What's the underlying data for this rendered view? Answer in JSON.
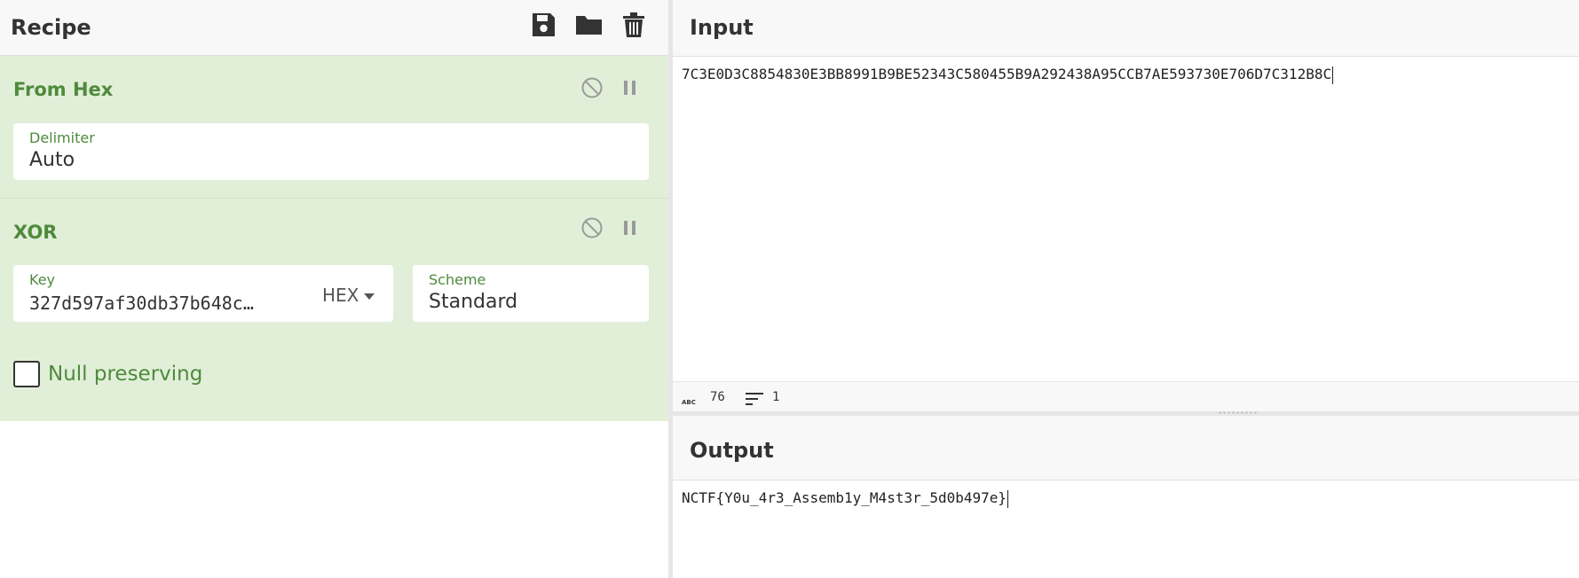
{
  "recipe": {
    "title": "Recipe",
    "icons": [
      "save-icon",
      "folder-icon",
      "trash-icon"
    ],
    "operations": [
      {
        "name": "From Hex",
        "fields": {
          "delimiter_label": "Delimiter",
          "delimiter_value": "Auto"
        }
      },
      {
        "name": "XOR",
        "fields": {
          "key_label": "Key",
          "key_value": "327d597af30db37b648c…",
          "key_format": "HEX",
          "scheme_label": "Scheme",
          "scheme_value": "Standard",
          "null_preserving_label": "Null preserving",
          "null_preserving_checked": false
        }
      }
    ]
  },
  "input": {
    "title": "Input",
    "text": "7C3E0D3C8854830E3BB8991B9BE52343C580455B9A292438A95CCB7AE593730E706D7C312B8C",
    "length": "76",
    "lines": "1"
  },
  "output": {
    "title": "Output",
    "text": "NCTF{Y0u_4r3_Assemb1y_M4st3r_5d0b497e}"
  },
  "colors": {
    "accent_green": "#4f8a3c",
    "operation_background": "#e1efd8"
  }
}
